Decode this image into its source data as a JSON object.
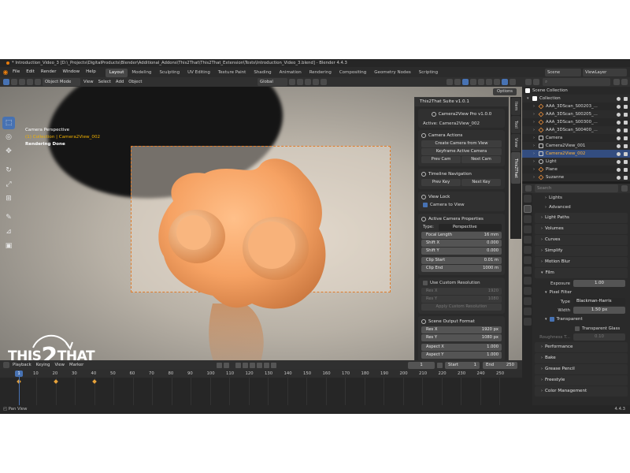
{
  "title_bar": "* Introduction_Video_3 [D:\\_Projects\\DigitalProducts\\Blender\\Additional_Addons\\This2That\\This2That_Extension\\Tests\\Introduction_Video_3.blend] - Blender 4.4.3",
  "menu": [
    "File",
    "Edit",
    "Render",
    "Window",
    "Help"
  ],
  "workspaces": [
    "Layout",
    "Modeling",
    "Sculpting",
    "UV Editing",
    "Texture Paint",
    "Shading",
    "Animation",
    "Rendering",
    "Compositing",
    "Geometry Nodes",
    "Scripting"
  ],
  "active_workspace": "Layout",
  "scene": "Scene",
  "view_layer": "ViewLayer",
  "viewport_header": {
    "mode": "Object Mode",
    "menus": [
      "View",
      "Select",
      "Add",
      "Object"
    ],
    "transform_orientation": "Global"
  },
  "viewport_overlay": {
    "view_name": "Camera Perspective",
    "collection_line": "(1) Collection | Camera2View_002",
    "render_status": "Rendering Done"
  },
  "options_label": "Options",
  "logo": {
    "part1": "THIS",
    "part2": "2",
    "part3": "THAT"
  },
  "npanel": {
    "suite_title": "This2That Suite v1.0.1",
    "pro_title": "Camera2View Pro v1.0.0",
    "active_label": "Active: Camera2View_002",
    "camera_actions": {
      "heading": "Camera Actions",
      "create": "Create Camera from View",
      "keyframe": "Keyframe Active Camera",
      "prev": "Prev Cam",
      "next": "Next Cam"
    },
    "timeline_nav": {
      "heading": "Timeline Navigation",
      "prev": "Prev Key",
      "next": "Next Key"
    },
    "view_lock": {
      "heading": "View Lock",
      "camera_to_view": "Camera to View"
    },
    "active_props": {
      "heading": "Active Camera Properties",
      "type_label": "Type:",
      "type_value": "Perspective",
      "fields": [
        {
          "label": "Focal Length",
          "value": "16 mm"
        },
        {
          "label": "Shift X",
          "value": "0.000"
        },
        {
          "label": "Shift Y",
          "value": "0.000"
        },
        {
          "label": "Clip Start",
          "value": "0.01 m"
        },
        {
          "label": "Clip End",
          "value": "1000 m"
        }
      ]
    },
    "custom_res": {
      "heading": "Use Custom Resolution",
      "res_x_label": "Res X",
      "res_x": "1920",
      "res_y_label": "Res Y",
      "res_y": "1080",
      "apply": "Apply Custom Resolution"
    },
    "scene_output": {
      "heading": "Scene Output Format",
      "fields": [
        {
          "label": "Res X",
          "value": "1920 px"
        },
        {
          "label": "Res Y",
          "value": "1080 px"
        },
        {
          "label": "Aspect X",
          "value": "1.000"
        },
        {
          "label": "Aspect Y",
          "value": "1.000"
        }
      ]
    }
  },
  "side_tabs": [
    "Item",
    "Tool",
    "View",
    "This2That"
  ],
  "outliner": {
    "root": "Scene Collection",
    "collection": "Collection",
    "items": [
      {
        "name": "AAA_3DScan_S00203_...",
        "type": "mesh"
      },
      {
        "name": "AAA_3DScan_S00205_...",
        "type": "mesh"
      },
      {
        "name": "AAA_3DScan_S00300_...",
        "type": "mesh"
      },
      {
        "name": "AAA_3DScan_S00400_...",
        "type": "mesh"
      },
      {
        "name": "Camera",
        "type": "cam"
      },
      {
        "name": "Camera2View_001",
        "type": "cam"
      },
      {
        "name": "Camera2View_002",
        "type": "cam",
        "selected": true
      },
      {
        "name": "Light",
        "type": "light"
      },
      {
        "name": "Plane",
        "type": "mesh"
      },
      {
        "name": "Suzanne",
        "type": "mesh"
      }
    ]
  },
  "properties": {
    "search_placeholder": "Search",
    "rows": [
      {
        "kind": "sub",
        "label": "Lights"
      },
      {
        "kind": "sub",
        "label": "Advanced"
      },
      {
        "kind": "sec",
        "label": "Light Paths"
      },
      {
        "kind": "sec",
        "label": "Volumes"
      },
      {
        "kind": "sec",
        "label": "Curves"
      },
      {
        "kind": "sec",
        "label": "Simplify"
      },
      {
        "kind": "sec",
        "label": "Motion Blur"
      },
      {
        "kind": "sec",
        "label": "Film"
      }
    ],
    "exposure_label": "Exposure",
    "exposure_value": "1.00",
    "pixel_filter": "Pixel Filter",
    "type_label": "Type",
    "type_value": "Blackman-Harris",
    "width_label": "Width",
    "width_value": "1.50 px",
    "transparent": "Transparent",
    "transparent_glass": "Transparent Glass",
    "roughness_label": "Roughness T...",
    "roughness_value": "0.10",
    "bottom_rows": [
      "Performance",
      "Bake",
      "Grease Pencil",
      "Freestyle",
      "Color Management"
    ]
  },
  "timeline": {
    "menus": [
      "Playback",
      "Keying",
      "View",
      "Marker"
    ],
    "current_frame": "1",
    "start_label": "Start",
    "start": "1",
    "end_label": "End",
    "end": "250",
    "ticks": [
      "1",
      "10",
      "20",
      "30",
      "40",
      "50",
      "60",
      "70",
      "80",
      "90",
      "100",
      "110",
      "120",
      "130",
      "140",
      "150",
      "160",
      "170",
      "180",
      "190",
      "200",
      "210",
      "220",
      "230",
      "240",
      "250"
    ],
    "keyframes": [
      1,
      20,
      40
    ]
  },
  "status": {
    "left": "Pan View",
    "version": "4.4.3"
  }
}
